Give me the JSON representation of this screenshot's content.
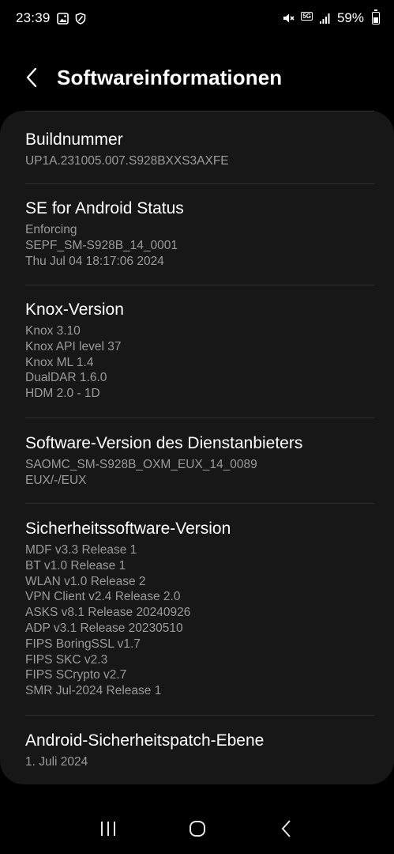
{
  "status_bar": {
    "time": "23:39",
    "network": "5G",
    "battery": "59%",
    "battery_level": 0.59
  },
  "header": {
    "title": "Softwareinformationen"
  },
  "sections": [
    {
      "title": "Buildnummer",
      "lines": [
        "UP1A.231005.007.S928BXXS3AXFE"
      ]
    },
    {
      "title": "SE for Android Status",
      "lines": [
        "Enforcing",
        "SEPF_SM-S928B_14_0001",
        "Thu Jul 04 18:17:06 2024"
      ]
    },
    {
      "title": "Knox-Version",
      "lines": [
        "Knox 3.10",
        "Knox API level 37",
        "Knox ML 1.4",
        "DualDAR 1.6.0",
        "HDM 2.0 - 1D"
      ]
    },
    {
      "title": "Software-Version des Dienstanbieters",
      "lines": [
        "SAOMC_SM-S928B_OXM_EUX_14_0089",
        "EUX/-/EUX"
      ]
    },
    {
      "title": "Sicherheitssoftware-Version",
      "lines": [
        "MDF v3.3 Release 1",
        "BT v1.0 Release 1",
        "WLAN v1.0 Release 2",
        "VPN Client v2.4 Release 2.0",
        "ASKS v8.1  Release 20240926",
        "ADP v3.1 Release 20230510",
        "FIPS BoringSSL v1.7",
        "FIPS SKC v2.3",
        "FIPS SCrypto v2.7",
        "SMR Jul-2024 Release 1"
      ]
    },
    {
      "title": "Android-Sicherheitspatch-Ebene",
      "lines": [
        "1. Juli 2024"
      ]
    }
  ]
}
